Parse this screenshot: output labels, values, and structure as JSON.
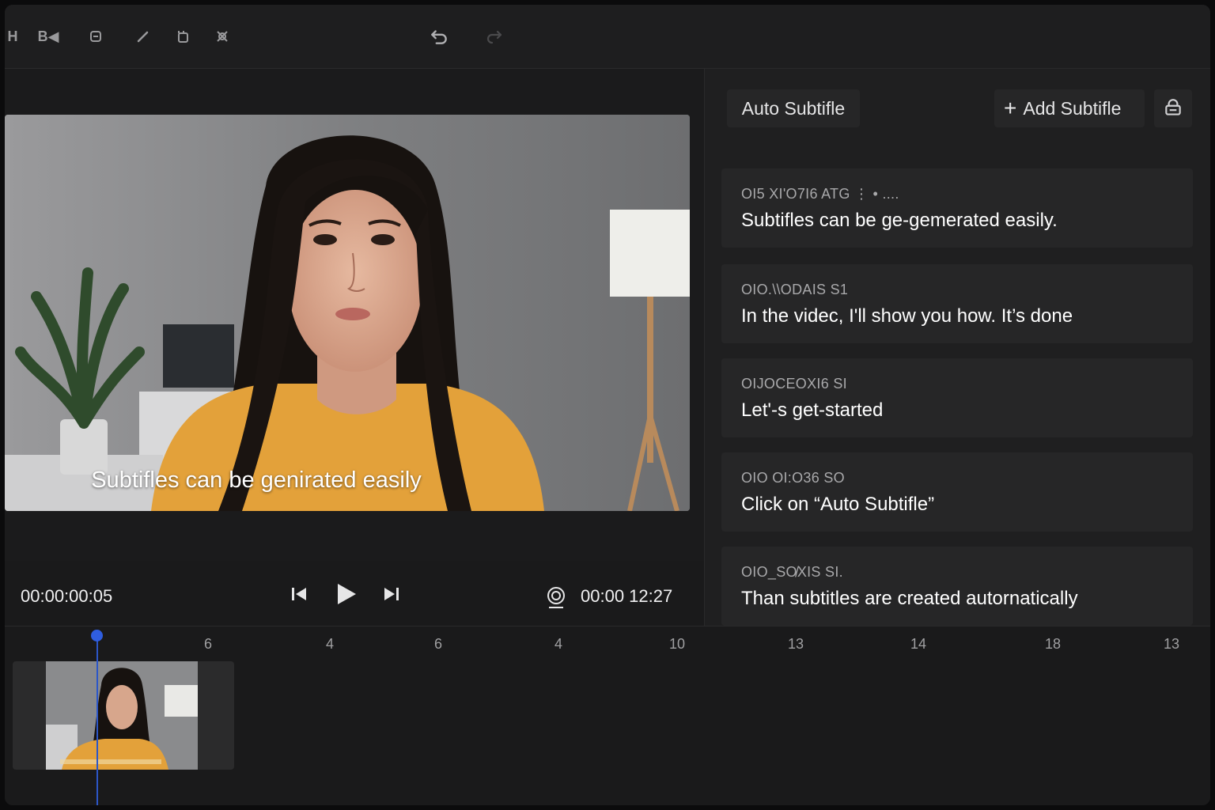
{
  "toolbar": {
    "tools": [
      {
        "name": "heading-tool",
        "label": "H"
      },
      {
        "name": "bold-tool",
        "label": "B◀"
      }
    ],
    "icons": [
      "subtitle-icon",
      "pen-icon",
      "duplicate-icon",
      "effects-icon",
      "undo-icon",
      "redo-icon"
    ]
  },
  "preview": {
    "caption": "Subtifles can be genirated easily"
  },
  "side_panel": {
    "auto_subtitle_label": "Auto Subtifle",
    "add_subtitle_label": "Add Subtifle",
    "add_icon": "plus-icon",
    "settings_icon": "caption-settings-icon",
    "items": [
      {
        "timestamp": "OI5 XI'O7I6 ATG ⋮    • ....",
        "text": "Subtifles can be ge-gemerated easily."
      },
      {
        "timestamp": "OIO.\\\\ODAIS S1",
        "text": "In the videc, I'll show you how. It’s done"
      },
      {
        "timestamp": "OIJOCEOXI6 SI",
        "text": "Let'‑s get-started"
      },
      {
        "timestamp": "OIO OI:O36 SO",
        "text": "Click on “Auto Subtifle”"
      },
      {
        "timestamp": "OIO_SO̸XIS SI.",
        "text": "Than subtitles are created autornatically"
      }
    ]
  },
  "transport": {
    "current_time": "00:00:00:05",
    "total_time": "00:00 12:27",
    "icons": [
      "skip-back-icon",
      "play-icon",
      "skip-forward-icon",
      "record-icon"
    ]
  },
  "timeline": {
    "ticks": [
      "6",
      "4",
      "6",
      "4",
      "10",
      "13",
      "14",
      "18",
      "13"
    ],
    "playhead_icon": "playhead-icon"
  },
  "colors": {
    "background": "#1b1b1c",
    "panel": "#262627",
    "accent": "#2f5ee0",
    "shirt": "#e3a13a"
  }
}
